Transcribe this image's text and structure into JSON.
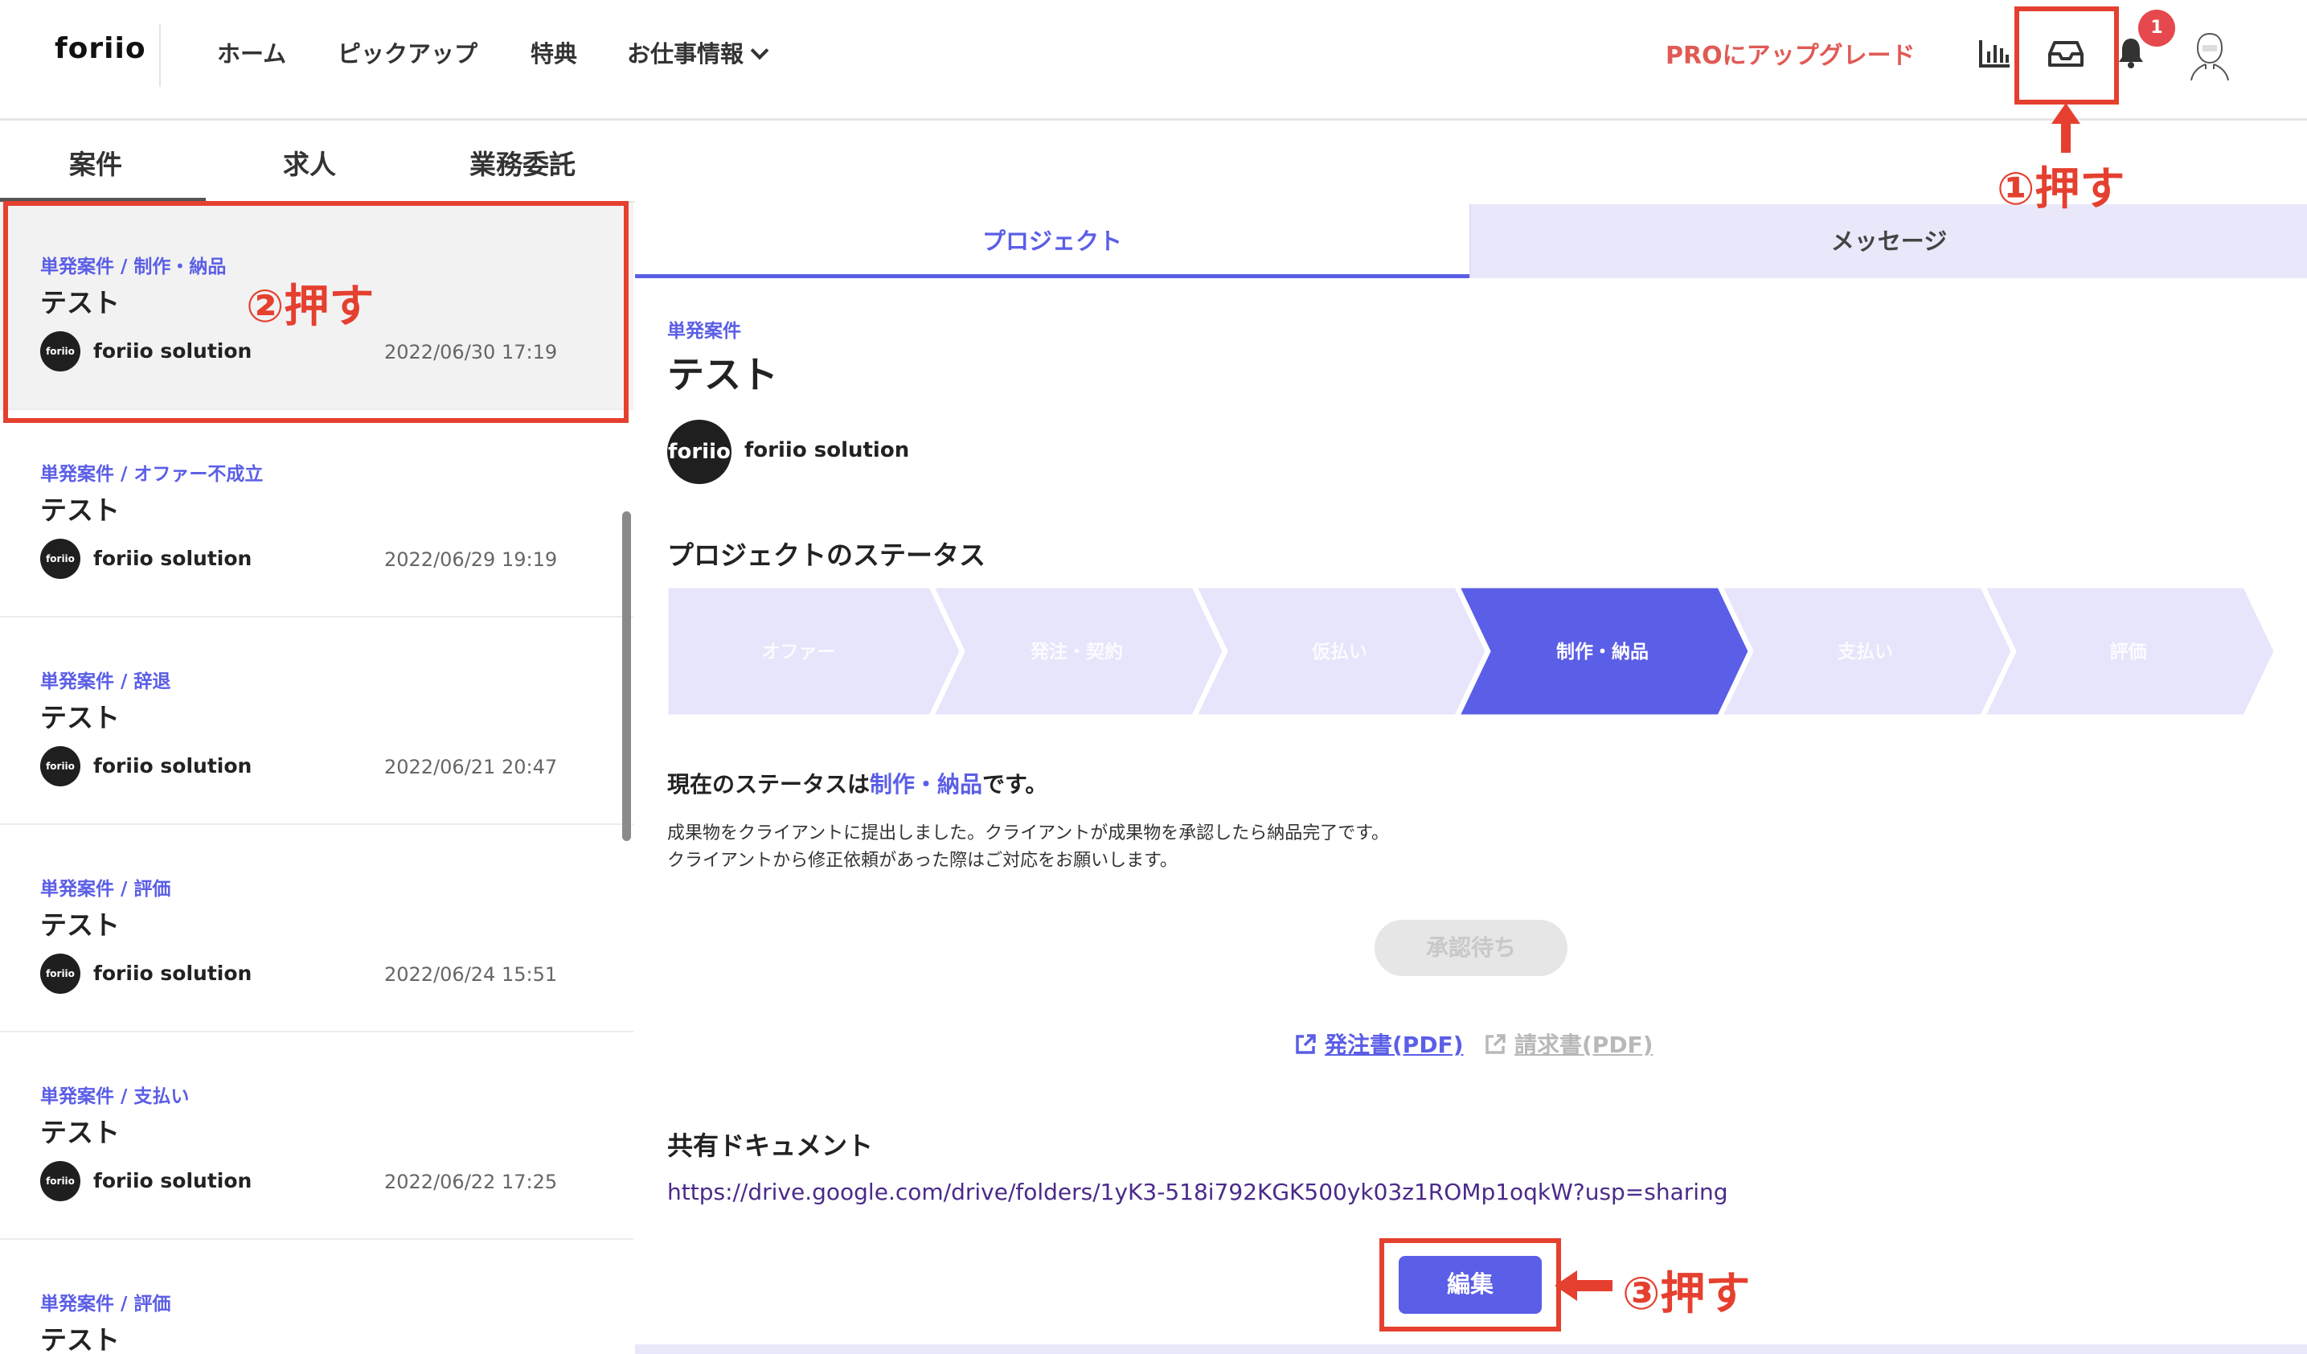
{
  "header": {
    "logo": "foriio",
    "nav": [
      "ホーム",
      "ピックアップ",
      "特典",
      "お仕事情報"
    ],
    "pro_upgrade": "PROにアップグレード",
    "notification_count": "1",
    "icons": [
      "stats-icon",
      "inbox-icon",
      "bell-icon",
      "avatar"
    ]
  },
  "left_tabs": [
    "案件",
    "求人",
    "業務委託"
  ],
  "projects": [
    {
      "category": "単発案件 / 制作・納品",
      "title": "テスト",
      "company": "foriio solution",
      "date": "2022/06/30 17:19",
      "avatar": "foriio"
    },
    {
      "category": "単発案件 / オファー不成立",
      "title": "テスト",
      "company": "foriio solution",
      "date": "2022/06/29 19:19",
      "avatar": "foriio"
    },
    {
      "category": "単発案件 / 辞退",
      "title": "テスト",
      "company": "foriio solution",
      "date": "2022/06/21 20:47",
      "avatar": "foriio"
    },
    {
      "category": "単発案件 / 評価",
      "title": "テスト",
      "company": "foriio solution",
      "date": "2022/06/24 15:51",
      "avatar": "foriio"
    },
    {
      "category": "単発案件 / 支払い",
      "title": "テスト",
      "company": "foriio solution",
      "date": "2022/06/22 17:25",
      "avatar": "foriio"
    },
    {
      "category": "単発案件 / 評価",
      "title": "テスト"
    }
  ],
  "detail_tabs": {
    "project": "プロジェクト",
    "message": "メッセージ"
  },
  "detail": {
    "type": "単発案件",
    "title": "テスト",
    "company": "foriio solution",
    "avatar": "foriio",
    "status_heading": "プロジェクトのステータス",
    "steps": [
      "オファー",
      "発注・契約",
      "仮払い",
      "制作・納品",
      "支払い",
      "評価"
    ],
    "active_step": 3,
    "current_status_prefix": "現在のステータスは",
    "current_status_value": "制作・納品",
    "current_status_suffix": "です。",
    "description": [
      "成果物をクライアントに提出しました。クライアントが成果物を承認したら納品完了です。",
      "クライアントから修正依頼があった際はご対応をお願いします。"
    ],
    "await_button": "承認待ち",
    "pdf_order": "発注書(PDF)",
    "pdf_invoice": "請求書(PDF)",
    "docs_heading": "共有ドキュメント",
    "docs_url": "https://drive.google.com/drive/folders/1yK3-518i792KGK500yk03z1ROMp1oqkW?usp=sharing",
    "edit_button": "編集"
  },
  "annotations": {
    "step1": "①押す",
    "step2": "②押す",
    "step3": "③押す"
  },
  "colors": {
    "accent": "#5b5ee6",
    "annotation": "#e5402f",
    "pro": "#e05a55"
  }
}
